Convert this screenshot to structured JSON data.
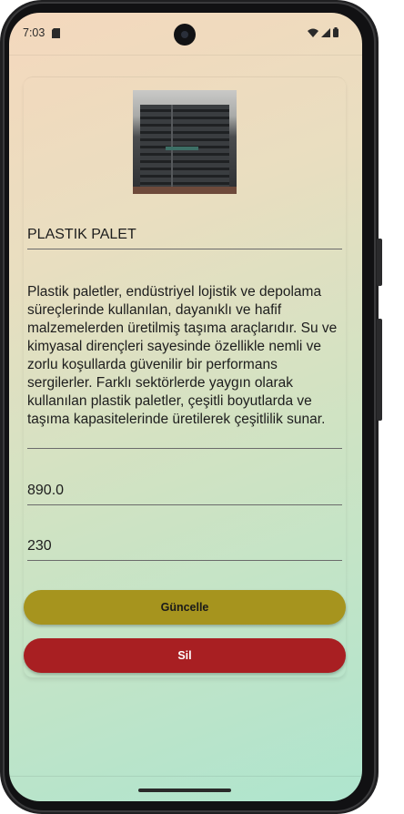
{
  "status_bar": {
    "time": "7:03",
    "icons": [
      "sd-card-icon",
      "wifi-icon",
      "signal-icon",
      "battery-icon"
    ]
  },
  "product": {
    "image_alt": "stacked black plastic pallets photo",
    "name": "PLASTIK PALET",
    "description": "Plastik paletler, endüstriyel lojistik ve depolama süreçlerinde kullanılan, dayanıklı ve hafif malzemelerden üretilmiş taşıma araçlarıdır. Su ve kimyasal dirençleri sayesinde özellikle nemli ve zorlu koşullarda güvenilir bir performans sergilerler. Farklı sektörlerde yaygın olarak kullanılan plastik paletler, çeşitli boyutlarda ve taşıma kapasitelerinde üretilerek çeşitlilik sunar.",
    "price": "890.0",
    "stock": "230"
  },
  "actions": {
    "update_label": "Güncelle",
    "delete_label": "Sil"
  },
  "colors": {
    "update_button": "#a6941e",
    "delete_button": "#a81f22",
    "gradient_top": "#f4d8bd",
    "gradient_bottom": "#aee5ce"
  }
}
